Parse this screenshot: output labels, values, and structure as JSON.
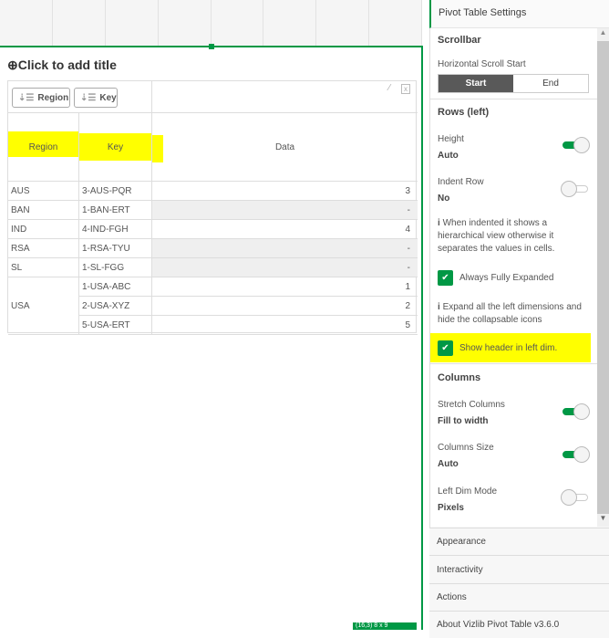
{
  "canvas": {
    "title_placeholder": "Click to add title",
    "status_badge": "(16,3) 8 x 9"
  },
  "table": {
    "toolbar": {
      "region_button": "Region",
      "key_button": "Key"
    },
    "headers": {
      "region": "Region",
      "key": "Key",
      "data": "Data"
    },
    "rows": [
      {
        "region": "AUS",
        "key": "3-AUS-PQR",
        "data": "3"
      },
      {
        "region": "BAN",
        "key": "1-BAN-ERT",
        "data": "-"
      },
      {
        "region": "IND",
        "key": "4-IND-FGH",
        "data": "4"
      },
      {
        "region": "RSA",
        "key": "1-RSA-TYU",
        "data": "-"
      },
      {
        "region": "SL",
        "key": "1-SL-FGG",
        "data": "-"
      },
      {
        "region": "USA",
        "key": "1-USA-ABC",
        "data": "1"
      },
      {
        "region": "",
        "key": "2-USA-XYZ",
        "data": "2"
      },
      {
        "region": "",
        "key": "5-USA-ERT",
        "data": "5"
      }
    ]
  },
  "panel": {
    "header": "Pivot Table Settings",
    "scrollbar": {
      "title": "Scrollbar",
      "label": "Horizontal Scroll Start",
      "options": [
        "Start",
        "End"
      ],
      "selected": "Start"
    },
    "rows": {
      "title": "Rows (left)",
      "height_label": "Height",
      "height_value": "Auto",
      "height_on": true,
      "indent_label": "Indent Row",
      "indent_value": "No",
      "indent_on": false,
      "indent_info": "When indented it shows a hierarchical view otherwise it separates the values in cells.",
      "always_expanded": "Always Fully Expanded",
      "expand_info": "Expand all the left dimensions and hide the collapsable icons",
      "show_header": "Show header in left dim."
    },
    "columns": {
      "title": "Columns",
      "stretch_label": "Stretch Columns",
      "stretch_value": "Fill to width",
      "size_label": "Columns Size",
      "size_value": "Auto",
      "leftdim_label": "Left Dim Mode",
      "leftdim_value": "Pixels"
    },
    "sections": [
      "Appearance",
      "Interactivity",
      "Actions",
      "About Vizlib Pivot Table v3.6.0"
    ]
  },
  "colors": {
    "accent": "#009845",
    "highlight": "#ffff00"
  }
}
